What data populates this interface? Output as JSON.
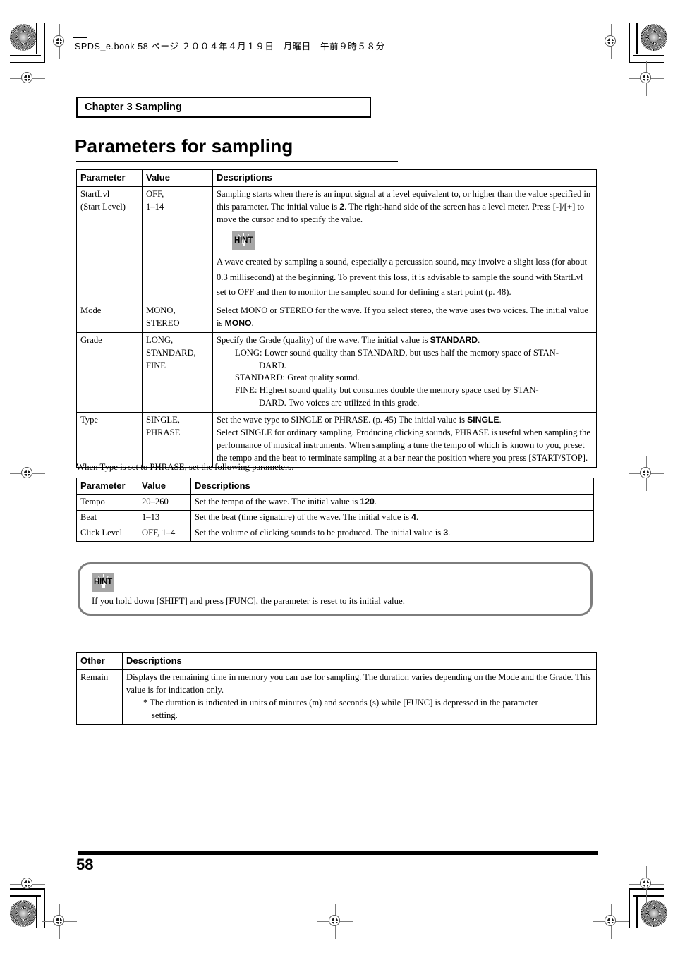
{
  "page": {
    "slug": "SPDS_e.book  58 ページ  ２００４年４月１９日　月曜日　午前９時５８分",
    "chapter": "Chapter 3 Sampling",
    "title": "Parameters for sampling",
    "page_number": "58"
  },
  "icons": {
    "hint_label": "HINT"
  },
  "table_sampling": {
    "headers": [
      "Parameter",
      "Value",
      "Descriptions"
    ],
    "rows": [
      {
        "parameter_line1": "StartLvl",
        "parameter_line2": "(Start Level)",
        "value_line1": "OFF,",
        "value_line2": "1–14",
        "desc_main_a": "Sampling starts when there is an input signal at a level equivalent to, or higher than the value specified in this parameter. The initial value is ",
        "desc_main_bold": "2",
        "desc_main_b": ". The right-hand side of the screen has a level meter. Press [-]/[+] to move the cursor and to specify the value.",
        "hint_text": "A wave created by sampling a sound, especially a percussion sound, may involve a slight loss (for about 0.3 millisecond) at the beginning. To prevent this loss, it is advisable to sample the sound with StartLvl set to OFF and then to monitor the sampled sound for defining a start point (p. 48)."
      },
      {
        "parameter_line1": "Mode",
        "value_line1": "MONO,",
        "value_line2": "STEREO",
        "desc_a": "Select MONO or STEREO for the wave. If you select stereo, the wave uses two voices. The initial value is ",
        "desc_bold": "MONO",
        "desc_b": "."
      },
      {
        "parameter_line1": "Grade",
        "value_line1": "LONG,",
        "value_line2": "STANDARD,",
        "value_line3": "FINE",
        "desc_a": "Specify the Grade (quality) of the wave. The initial value is ",
        "desc_bold": "STANDARD",
        "desc_b": ".",
        "bullet_long": "LONG: Lower sound quality than STANDARD, but uses half the memory space of STAN-",
        "bullet_long_cont": "DARD.",
        "bullet_standard": "STANDARD: Great quality sound.",
        "bullet_fine": "FINE: Highest sound quality but consumes double the memory space used by STAN-",
        "bullet_fine_cont": "DARD. Two voices are utilized in this grade."
      },
      {
        "parameter_line1": "Type",
        "value_line1": "SINGLE,",
        "value_line2": "PHRASE",
        "desc_a": "Set the wave type to SINGLE or PHRASE. (p. 45) The initial value is ",
        "desc_bold": "SINGLE",
        "desc_b": ".",
        "desc_c": "Select SINGLE for ordinary sampling. Producing clicking sounds, PHRASE is useful when sampling the performance of musical instruments. When sampling a tune the tempo of which is known to you, preset the tempo and the beat to terminate sampling at a bar near the position where you press [START/STOP]."
      }
    ]
  },
  "lead_sentence": "When Type is set to PHRASE, set the following parameters.",
  "table_phrase": {
    "headers": [
      "Parameter",
      "Value",
      "Descriptions"
    ],
    "rows": [
      {
        "parameter": "Tempo",
        "value": "20–260",
        "desc_a": "Set the tempo of the wave. The initial value is ",
        "desc_bold": "120",
        "desc_b": "."
      },
      {
        "parameter": "Beat",
        "value": "1–13",
        "desc_a": "Set the beat (time signature) of the wave. The initial value is ",
        "desc_bold": "4",
        "desc_b": "."
      },
      {
        "parameter": "Click Level",
        "value": "OFF, 1–4",
        "desc_a": "Set the volume of clicking sounds to be produced. The initial value is ",
        "desc_bold": "3",
        "desc_b": "."
      }
    ]
  },
  "hint_callout": {
    "text": "If you hold down [SHIFT] and press [FUNC], the parameter is reset to its initial value."
  },
  "table_other": {
    "headers": [
      "Other",
      "Descriptions"
    ],
    "rows": [
      {
        "other": "Remain",
        "desc_main": "Displays the remaining time in memory you can use for sampling. The duration varies depending on the Mode and the Grade. This value is for indication only.",
        "desc_note": "* The duration is indicated in units of minutes (m) and seconds (s) while [FUNC] is depressed in the parameter",
        "desc_note_cont": "setting."
      }
    ]
  },
  "colors": {
    "text": "#000000",
    "hint_icon_bg": "#a6a6a6",
    "hint_box_border": "#7d7d7d",
    "page_bg": "#ffffff"
  }
}
